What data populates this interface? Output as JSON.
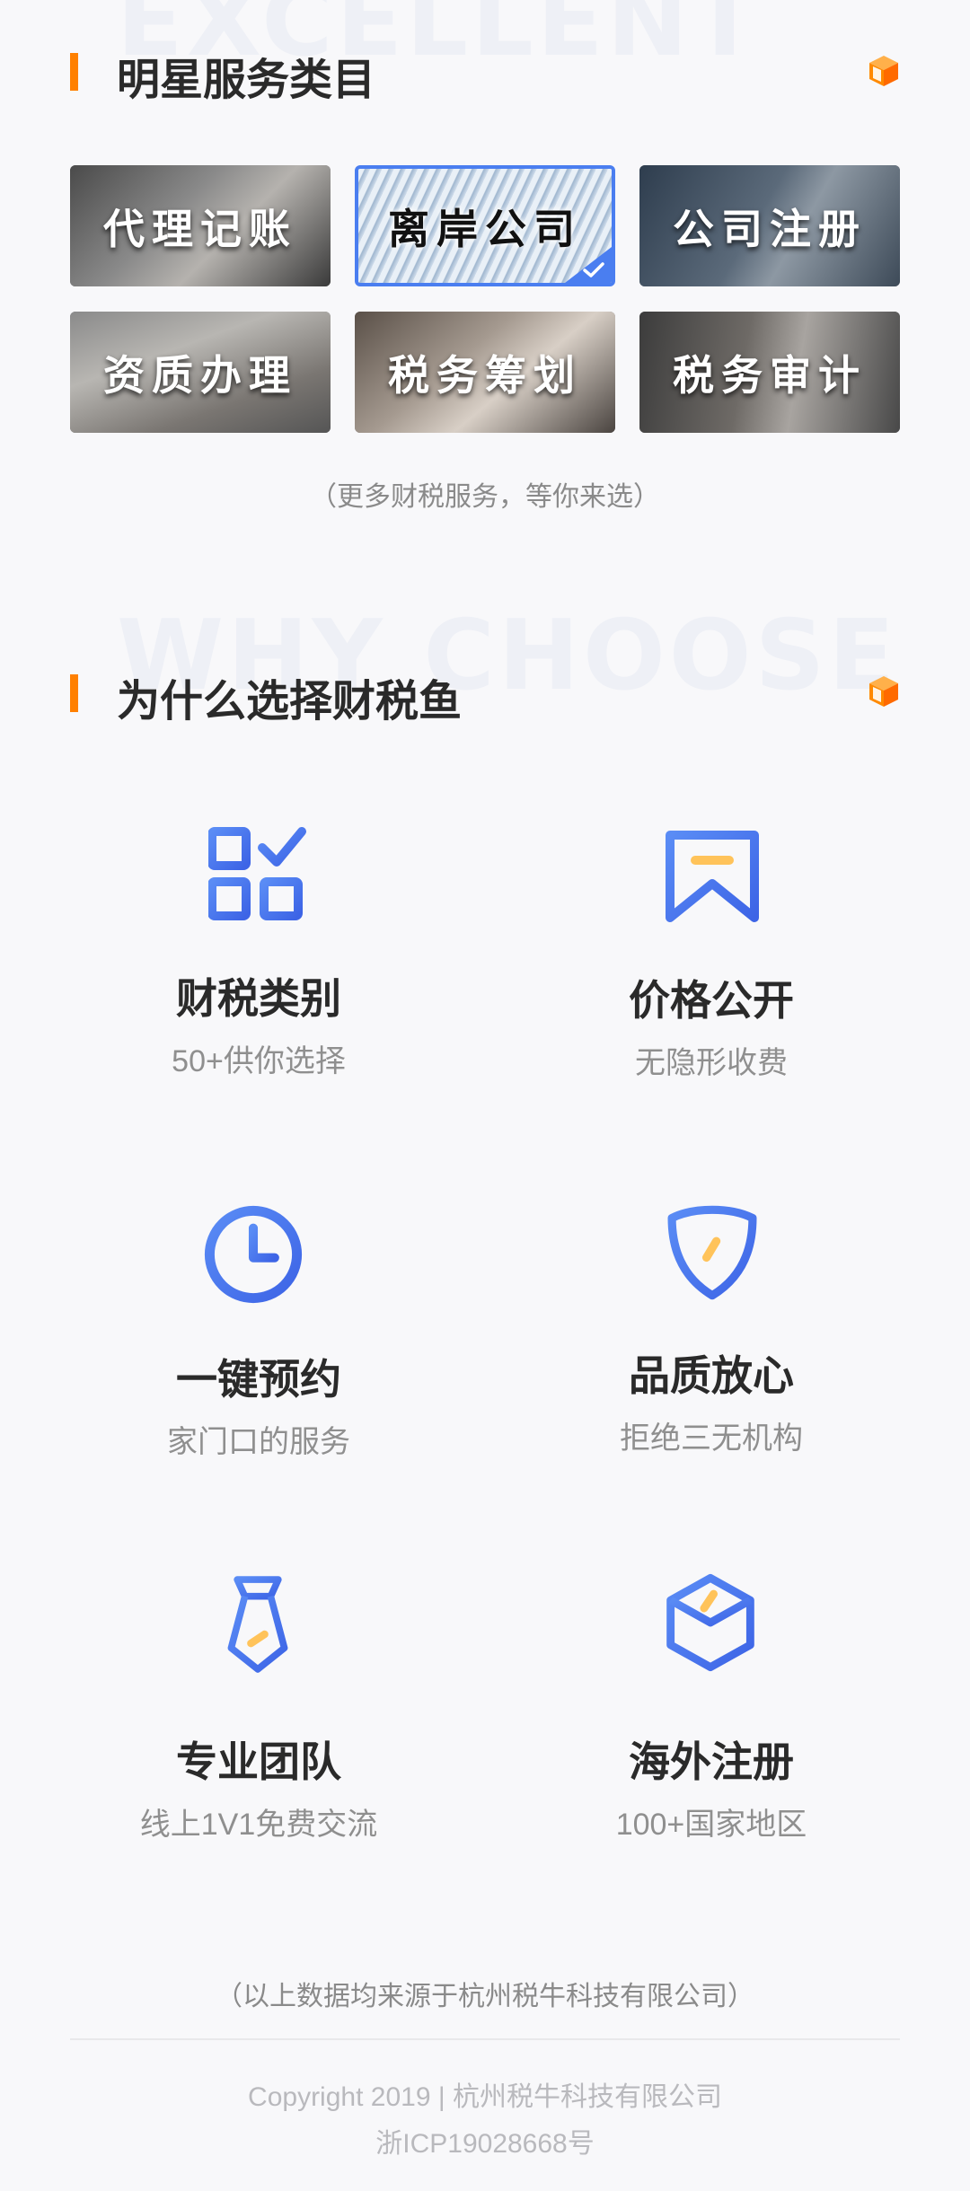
{
  "section1": {
    "watermark": "EXCELLENT",
    "title": "明星服务类目",
    "tiles": [
      {
        "label": "代理记账",
        "selected": false
      },
      {
        "label": "离岸公司",
        "selected": true
      },
      {
        "label": "公司注册",
        "selected": false
      },
      {
        "label": "资质办理",
        "selected": false
      },
      {
        "label": "税务筹划",
        "selected": false
      },
      {
        "label": "税务审计",
        "selected": false
      }
    ],
    "more_note": "（更多财税服务，等你来选）"
  },
  "section2": {
    "watermark": "WHY CHOOSE",
    "title": "为什么选择财税鱼",
    "features": [
      {
        "icon": "category-check-icon",
        "title": "财税类别",
        "subtitle": "50+供你选择"
      },
      {
        "icon": "bookmark-icon",
        "title": "价格公开",
        "subtitle": "无隐形收费"
      },
      {
        "icon": "clock-icon",
        "title": "一键预约",
        "subtitle": "家门口的服务"
      },
      {
        "icon": "shield-icon",
        "title": "品质放心",
        "subtitle": "拒绝三无机构"
      },
      {
        "icon": "tie-icon",
        "title": "专业团队",
        "subtitle": "线上1V1免费交流"
      },
      {
        "icon": "cube-icon",
        "title": "海外注册",
        "subtitle": "100+国家地区"
      }
    ],
    "data_note": "（以上数据均来源于杭州税牛科技有限公司）"
  },
  "footer": {
    "copyright": "Copyright 2019 | 杭州税牛科技有限公司",
    "icp": "浙ICP19028668号"
  },
  "colors": {
    "accent_orange": "#ff8000",
    "accent_blue": "#4a7ef0",
    "highlight_yellow": "#ffc35a"
  }
}
